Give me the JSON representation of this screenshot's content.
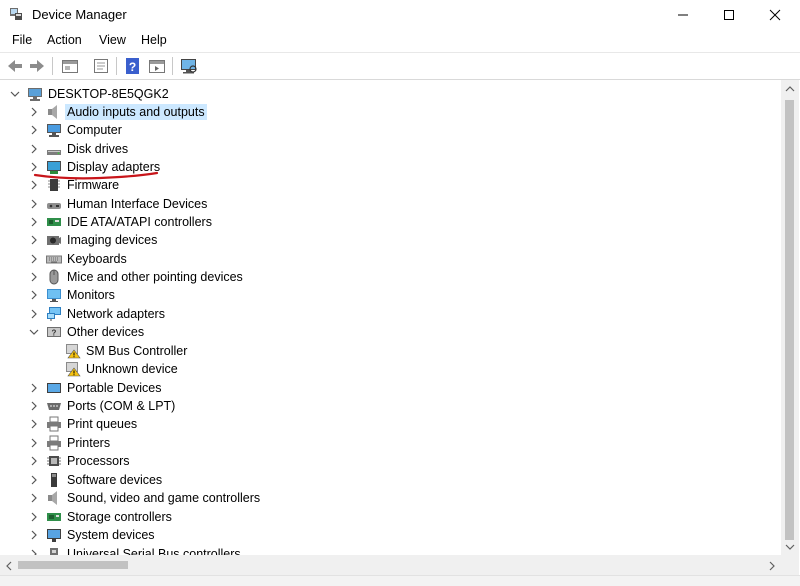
{
  "window": {
    "title": "Device Manager",
    "icon": "device-manager-icon",
    "controls": [
      "minimize",
      "maximize",
      "close"
    ]
  },
  "menu": [
    "File",
    "Action",
    "View",
    "Help"
  ],
  "toolbar": [
    "back-icon",
    "forward-icon",
    "properties-icon",
    "update-driver-icon",
    "help-icon",
    "run-icon",
    "scan-hardware-icon"
  ],
  "tree": {
    "root": "DESKTOP-8E5QGK2",
    "categories": [
      {
        "label": "Audio inputs and outputs",
        "icon": "speaker-icon"
      },
      {
        "label": "Computer",
        "icon": "computer-icon"
      },
      {
        "label": "Disk drives",
        "icon": "disk-drive-icon"
      },
      {
        "label": "Display adapters",
        "icon": "display-adapter-icon"
      },
      {
        "label": "Firmware",
        "icon": "firmware-icon"
      },
      {
        "label": "Human Interface Devices",
        "icon": "hid-icon"
      },
      {
        "label": "IDE ATA/ATAPI controllers",
        "icon": "ide-controller-icon"
      },
      {
        "label": "Imaging devices",
        "icon": "camera-icon"
      },
      {
        "label": "Keyboards",
        "icon": "keyboard-icon"
      },
      {
        "label": "Mice and other pointing devices",
        "icon": "mouse-icon"
      },
      {
        "label": "Monitors",
        "icon": "monitor-icon"
      },
      {
        "label": "Network adapters",
        "icon": "network-icon"
      },
      {
        "label": "Other devices",
        "icon": "other-devices-icon"
      },
      {
        "label": "SM Bus Controller",
        "icon": "warning-device-icon"
      },
      {
        "label": "Unknown device",
        "icon": "warning-device-icon"
      },
      {
        "label": "Portable Devices",
        "icon": "portable-device-icon"
      },
      {
        "label": "Ports (COM & LPT)",
        "icon": "port-icon"
      },
      {
        "label": "Print queues",
        "icon": "printer-icon"
      },
      {
        "label": "Printers",
        "icon": "printer-icon"
      },
      {
        "label": "Processors",
        "icon": "processor-icon"
      },
      {
        "label": "Software devices",
        "icon": "software-device-icon"
      },
      {
        "label": "Sound, video and game controllers",
        "icon": "speaker-icon"
      },
      {
        "label": "Storage controllers",
        "icon": "storage-controller-icon"
      },
      {
        "label": "System devices",
        "icon": "system-device-icon"
      },
      {
        "label": "Universal Serial Bus controllers",
        "icon": "usb-icon"
      }
    ]
  },
  "colors": {
    "selection": "#cce8ff",
    "annotation": "#c8151a",
    "accent": "#0078d7"
  }
}
